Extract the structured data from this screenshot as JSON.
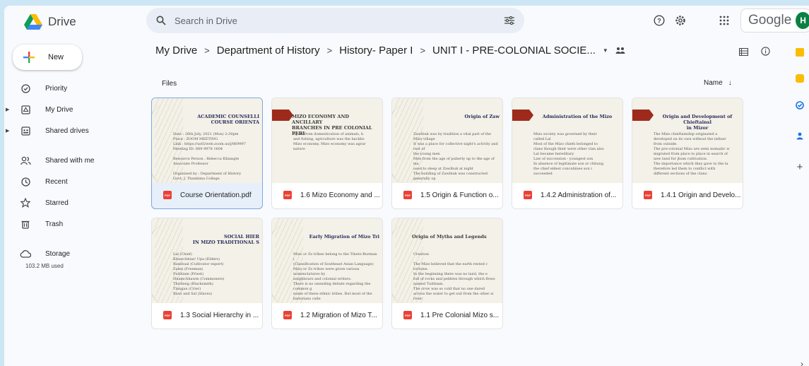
{
  "app": {
    "name": "Drive",
    "brand": "Google",
    "avatar_initial": "H",
    "colors": {
      "accent": "#0b57d0",
      "pdf": "#e94235",
      "avatar": "#0b8043"
    }
  },
  "search": {
    "placeholder": "Search in Drive"
  },
  "sidebar": {
    "new_label": "New",
    "items": [
      {
        "label": "Priority",
        "icon": "priority-icon"
      },
      {
        "label": "My Drive",
        "icon": "my-drive-icon"
      },
      {
        "label": "Shared drives",
        "icon": "shared-drives-icon"
      },
      {
        "label": "Shared with me",
        "icon": "shared-with-me-icon"
      },
      {
        "label": "Recent",
        "icon": "clock-icon"
      },
      {
        "label": "Starred",
        "icon": "star-icon"
      },
      {
        "label": "Trash",
        "icon": "trash-icon"
      },
      {
        "label": "Storage",
        "icon": "cloud-icon"
      }
    ],
    "storage_used": "103.2 MB used"
  },
  "breadcrumb": [
    "My Drive",
    "Department of History",
    "History- Paper I",
    "UNIT I - PRE-COLONIAL SOCIE..."
  ],
  "files": {
    "section_label": "Files",
    "sort_label": "Name",
    "items": [
      {
        "name": "Course Orientation.pdf",
        "thumb_title": "ACADEMIC COUNSELLI\nCOURSE ORIENTA",
        "thumb_body": "Date : 26th July, 2021 (Mon) 2:30pm\nPlace : ZOOM MEETING\nLink : https://us02web.zoom.us/j/869997\nMeeting ID: 869 9978 1604\n\nResource Person : Rebecca Khiangte\nAssociate Professor\n\nOrganized by : Department of History\nGovt. J. Thankima College"
      },
      {
        "name": "1.6 Mizo Economy and ...",
        "thumb_title": "MIZO ECONOMY AND ANCILLARY\nBRANCHES IN PRE COLONIAL PERI",
        "thumb_body": "Apart from domestication of animals, h\nand fishing, agriculture was the backbo\nMizo economy. Mizo economy was agrar\nnature"
      },
      {
        "name": "1.5 Origin & Function o...",
        "thumb_title": "Origin of Zaw",
        "thumb_body": "Zawlbuk was by tradition a vital part of the Mizo village\nIt was a place for collective night's activity and rest of\nthe young men\nMen from the age of puberty up to the age of ma\nused to sleep at Zawlbuk at night\nThe building of Zawlbuk was constructed generally op\nto the chief's house by the villagers\nIt was a big house to accommodate all the young m"
      },
      {
        "name": "1.4.2 Administration of...",
        "thumb_title": "Administration of the Mizo",
        "thumb_body": "Mizo society was governed by their\ncalled Lal\nMost of the Mizo chiefs belonged to\nclans though their were other clan also\nLal became hereditary\nLaw of succession - youngest son\nIn absence of legitimate son or chhung\nthe chief eldest concubines son i\nsucceeded"
      },
      {
        "name": "1.4.1 Origin and Develo...",
        "thumb_title": "Origin and Development of Chieftainsl\nin Mizor",
        "thumb_body": "The Mizo chieftainship originated a\ndeveloped on its own without the influer\nfrom outside.\nThe pre-colonial Mizo are semi nomadic w\nmigrated from place to place in search of\nnew land for jhum cultivation.\nThe importance which they gave to the la\ntherefore led them to conflict with\ndifferent sections of the clans."
      },
      {
        "name": "1.3 Social Hierarchy in ...",
        "thumb_title": "SOCIAL HIER\nIN MIZO TRADITIONAL S",
        "thumb_body": "Lal (Chief)\nKhawchhiar/ Upa (Elders)\nRamhual (Cultivator expert)\nZalen (Freeman)\nPuithiam (Priest)\nHnamchhawm (Commoners)\nThirdeng (Blacksmith)\nTlangau (Crier)\nBawi and Sal (Slaves)"
      },
      {
        "name": "1.2 Migration of Mizo T...",
        "thumb_title": "Early Migration of Mizo Tri",
        "thumb_body": "Mizo or Zo tribes belong to the Tibeto-Burman (\n(Classification of Southeast Asian Language)\nMizo or Zo tribes were given various nomenclatures by\nneighbours and colonial writers.\nThere is no unending debate regarding the common g\nname of these ethnic tribes. But most of the historians calle\nas 'Mizo'.\nThe major tribes/clans of the Mizo were Lusei, Ralte, I\nMara, Lai, Paite, Kuki etc."
      },
      {
        "name": "1.1 Pre Colonial Mizo s...",
        "thumb_title": "Origin of Myths and Legends",
        "thumb_body": "Creation\n\nThe Mizo believed that the earth rested c\ntortoise.\nIn the beginning there was no land, the e\nfull of rocks and pebbles through which flows\nnamed Tuithiam.\nThe crow was so cold that no one dared\nacross the water to get soil from the other si\nriver.\nAt last a porcupine was able to swim acros"
      }
    ]
  }
}
